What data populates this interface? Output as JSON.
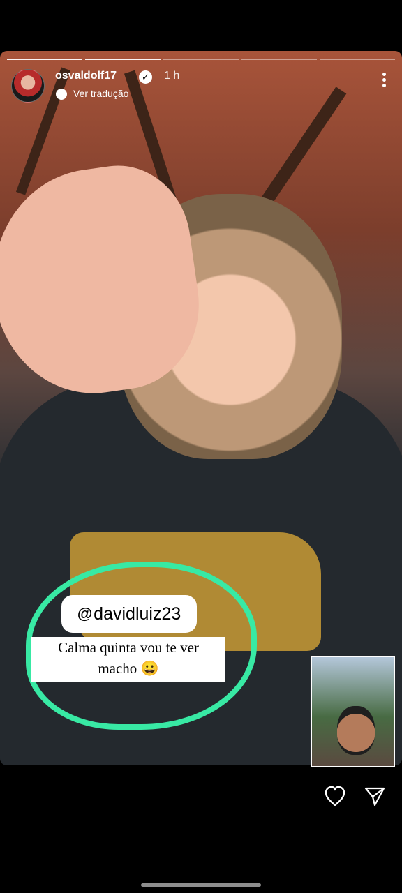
{
  "story": {
    "username": "osvaldolf17",
    "time": "1 h",
    "translate_label": "Ver tradução",
    "progress_segments": 5,
    "current_segment": 2
  },
  "overlay": {
    "mention": "davidluiz23",
    "comment_line_1": "Calma quinta vou te ver",
    "comment_line_2": "macho 😀"
  },
  "icons": {
    "verified": "verified-badge-icon",
    "translate": "translate-icon",
    "menu": "more-icon",
    "like": "heart-icon",
    "share": "send-icon"
  },
  "colors": {
    "highlight": "#38e9a4",
    "background": "#000000"
  }
}
